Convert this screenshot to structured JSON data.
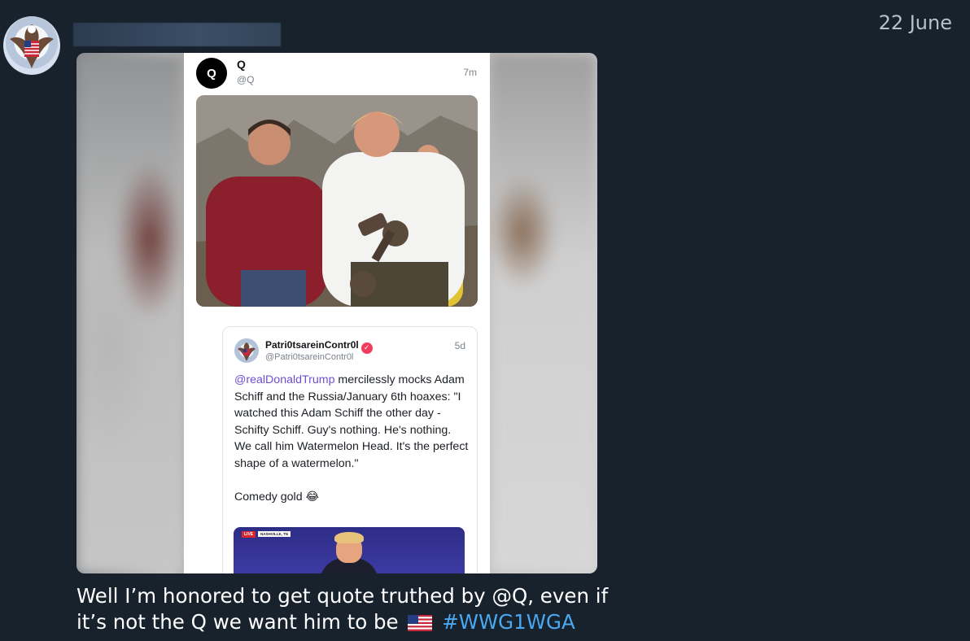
{
  "message": {
    "date": "22 June",
    "caption_text": "Well I’m honored to get quote truthed by @Q, even if it’s not the Q we want him to be",
    "caption_hashtag": "#WWG1WGA",
    "caption_emoji": "us-flag"
  },
  "post": {
    "avatar_letter": "Q",
    "name": "Q",
    "handle": "@Q",
    "time": "7m"
  },
  "quote": {
    "name": "Patri0tsareinContr0l",
    "handle": "@Patri0tsareinContr0l",
    "time": "5d",
    "mention": "@realDonaldTrump",
    "text": " mercilessly mocks Adam Schiff and the Russia/January 6th hoaxes: \"I watched this Adam Schiff the other day - Schifty Schiff. Guy's nothing. He's nothing. We call him Watermelon Head. It's the perfect shape of a watermelon.\"",
    "extra": "Comedy gold 😂",
    "video_live": "LIVE",
    "video_place": "NASHVILLE, TN"
  },
  "colors": {
    "background": "#18222d",
    "hashtag": "#4aa8f0",
    "mention": "#6d4fd6",
    "verified": "#f23e5d"
  }
}
